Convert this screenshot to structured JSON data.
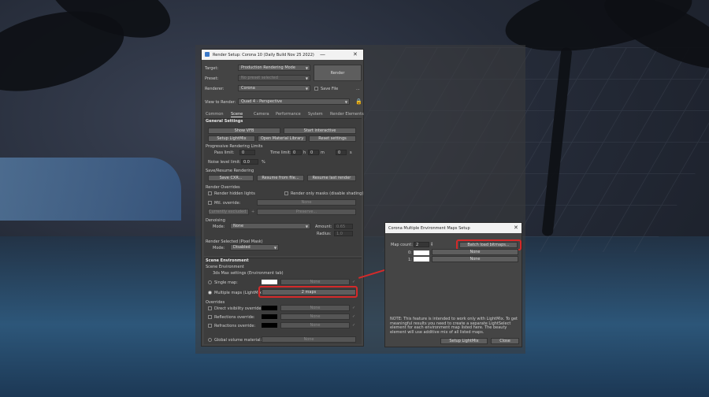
{
  "render_setup": {
    "title": "Render Setup: Corona 10 (Daily Build Nov 25 2022)",
    "target_label": "Target:",
    "target_value": "Production Rendering Mode",
    "preset_label": "Preset:",
    "preset_value": "No preset selected",
    "renderer_label": "Renderer:",
    "renderer_value": "Corona",
    "save_file_label": "Save File",
    "render_button": "Render",
    "ellipsis": "...",
    "view_label": "View to Render:",
    "view_value": "Quad 4 - Perspective",
    "tabs": [
      "Common",
      "Scene",
      "Camera",
      "Performance",
      "System",
      "Render Elements"
    ],
    "general_settings": {
      "header": "General Settings",
      "show_vfb": "Show VFB",
      "start_interactive": "Start interactive",
      "setup_lightmix": "Setup LightMix",
      "open_material_library": "Open Material Library",
      "reset_settings": "Reset settings",
      "progressive_limits": "Progressive Rendering Limits",
      "pass_limit_label": "Pass limit:",
      "pass_limit_value": "0",
      "time_limit_label": "Time limit:",
      "time_h": "0",
      "h_unit": "h",
      "time_m": "0",
      "m_unit": "m",
      "time_s": "0",
      "s_unit": "s",
      "noise_label": "Noise level limit:",
      "noise_value": "0.0",
      "noise_unit": "%",
      "save_resume": "Save/Resume Rendering",
      "save_cxr": "Save CXR...",
      "resume_from_file": "Resume from file...",
      "resume_last": "Resume last render",
      "render_overrides": "Render Overrides",
      "render_hidden_lights": "Render hidden lights",
      "render_only_masks": "Render only masks (disable shading)",
      "mtl_override": "Mtl. override:",
      "mtl_override_value": "None",
      "currently_excluded": "Currently excluded: 0",
      "exclude_plus": "+",
      "preserve": "Preserve...",
      "denoising": "Denoising",
      "mode_label": "Mode:",
      "denoise_mode": "None",
      "amount_label": "Amount:",
      "amount_value": "0.65",
      "radius_label": "Radius:",
      "radius_value": "1.0",
      "render_selected": "Render Selected (Pixel Mask)",
      "rs_mode_label": "Mode:",
      "rs_mode_value": "Disabled"
    },
    "scene_environment": {
      "header": "Scene Environment",
      "env_label": "Scene Environment",
      "max_settings": "3ds Max settings (Environment tab)",
      "single_map": "Single map:",
      "single_map_value": "None",
      "multiple_maps": "Multiple maps (LightMix):",
      "multiple_maps_value": "2 maps",
      "overrides": "Overrides",
      "direct_visibility": "Direct visibility override:",
      "direct_value": "None",
      "reflections": "Reflections override:",
      "reflections_value": "None",
      "refractions": "Refractions override:",
      "refractions_value": "None",
      "global_volume": "Global volume material:",
      "global_volume_value": "None"
    }
  },
  "env_dialog": {
    "title": "Corona Multiple Environment Maps Setup",
    "close_glyph": "✕",
    "map_count_label": "Map count:",
    "map_count_value": "2",
    "batch_load": "Batch load bitmaps...",
    "map0_label": "0:",
    "map0_value": "None",
    "map1_label": "1:",
    "map1_value": "None",
    "note": "NOTE: This feature is intended to work only with LightMix. To get meaningful results you need to create a separate LightSelect element for each environment map listed here. The beauty element will use additive mix of all listed maps.",
    "setup_lightmix": "Setup LightMix",
    "close_button": "Close"
  },
  "colors": {
    "highlight": "#d42a2a",
    "panel_bg": "#444444",
    "titlebar_bg": "#f2f2f2"
  }
}
